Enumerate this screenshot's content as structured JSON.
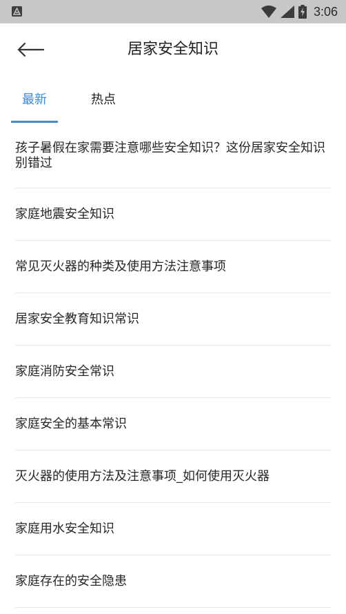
{
  "status_bar": {
    "time": "3:06",
    "icons": [
      "app-notification-icon",
      "wifi-icon",
      "cell-signal-icon",
      "battery-charging-icon"
    ]
  },
  "header": {
    "title": "居家安全知识",
    "back_icon": "arrow-left-icon"
  },
  "tabs": [
    {
      "label": "最新",
      "active": true
    },
    {
      "label": "热点",
      "active": false
    }
  ],
  "articles": [
    {
      "title": "孩子暑假在家需要注意哪些安全知识？这份居家安全知识别错过"
    },
    {
      "title": "家庭地震安全知识"
    },
    {
      "title": "常见灭火器的种类及使用方法注意事项"
    },
    {
      "title": "居家安全教育知识常识"
    },
    {
      "title": "家庭消防安全常识"
    },
    {
      "title": "家庭安全的基本常识"
    },
    {
      "title": "灭火器的使用方法及注意事项_如何使用灭火器"
    },
    {
      "title": "家庭用水安全知识"
    },
    {
      "title": "家庭存在的安全隐患"
    }
  ],
  "colors": {
    "accent": "#3e88d8",
    "status_bar": "#c7c7c7",
    "text": "#262626",
    "divider": "#e8e8e8"
  }
}
